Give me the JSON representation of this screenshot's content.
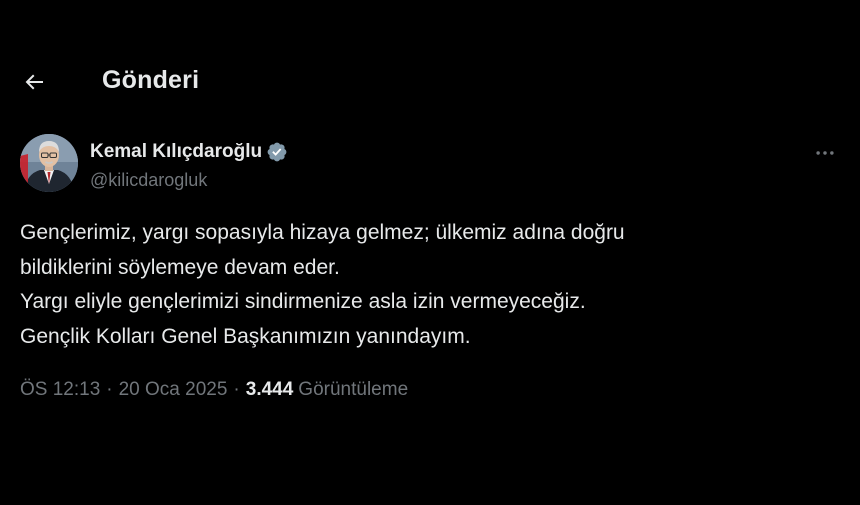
{
  "header": {
    "title": "Gönderi",
    "back_icon": "arrow-left-icon"
  },
  "author": {
    "display_name": "Kemal Kılıçdaroğlu",
    "handle": "@kilicdarogluk",
    "verified_icon": "verified-badge-icon",
    "verified_color": "#829aab",
    "more_icon": "more-horizontal-icon"
  },
  "tweet": {
    "lines": [
      "Gençlerimiz, yargı sopasıyla hizaya gelmez; ülkemiz adına doğru",
      "bildiklerini söylemeye devam eder.",
      "Yargı eliyle gençlerimizi sindirmenize asla izin vermeyeceğiz.",
      "Gençlik Kolları Genel Başkanımızın yanındayım."
    ]
  },
  "meta": {
    "time": "ÖS 12:13",
    "separator": "·",
    "date": "20 Oca 2025",
    "views_count": "3.444",
    "views_label": "Görüntüleme"
  },
  "colors": {
    "background": "#000000",
    "text_primary": "#e7e9ea",
    "text_secondary": "#71767b"
  }
}
